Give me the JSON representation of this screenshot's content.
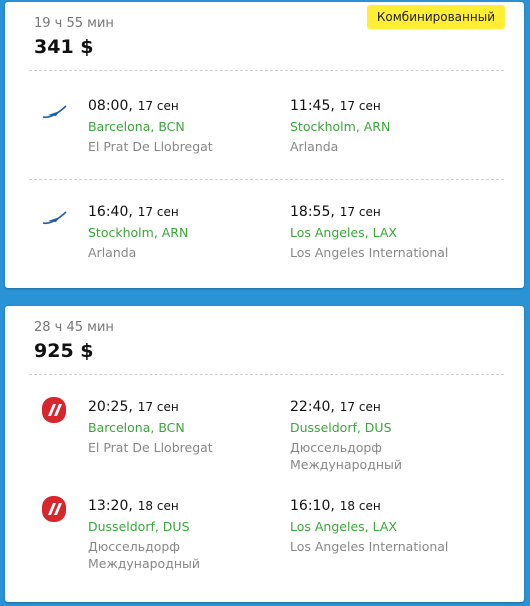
{
  "results": [
    {
      "duration": "19 ч 55 мин",
      "price": "341 $",
      "badge": "Комбинированный",
      "segments": [
        {
          "airline_icon": "blue-swoosh-airline-logo",
          "dep_time": "08:00,",
          "dep_date": "17 сен",
          "dep_city": "Barcelona, BCN",
          "dep_airport": "El Prat De Llobregat",
          "arr_time": "11:45,",
          "arr_date": "17 сен",
          "arr_city": "Stockholm, ARN",
          "arr_airport": "Arlanda"
        },
        {
          "airline_icon": "blue-swoosh-airline-logo",
          "dep_time": "16:40,",
          "dep_date": "17 сен",
          "dep_city": "Stockholm, ARN",
          "dep_airport": "Arlanda",
          "arr_time": "18:55,",
          "arr_date": "17 сен",
          "arr_city": "Los Angeles, LAX",
          "arr_airport": "Los Angeles International"
        }
      ]
    },
    {
      "duration": "28 ч 45 мин",
      "price": "925 $",
      "segments": [
        {
          "airline_icon": "red-airline-logo",
          "dep_time": "20:25,",
          "dep_date": "17 сен",
          "dep_city": "Barcelona, BCN",
          "dep_airport": "El Prat De Llobregat",
          "arr_time": "22:40,",
          "arr_date": "17 сен",
          "arr_city": "Dusseldorf, DUS",
          "arr_airport": "Дюссельдорф Международный"
        },
        {
          "airline_icon": "red-airline-logo",
          "dep_time": "13:20,",
          "dep_date": "18 сен",
          "dep_city": "Dusseldorf, DUS",
          "dep_airport": "Дюссельдорф Международный",
          "arr_time": "16:10,",
          "arr_date": "18 сен",
          "arr_city": "Los Angeles, LAX",
          "arr_airport": "Los Angeles International"
        }
      ]
    }
  ],
  "colors": {
    "background": "#2a93d5",
    "city_green": "#3aa63a",
    "badge_yellow": "#ffee33",
    "logo_red": "#d7262c",
    "logo_blue": "#1f5fa8"
  }
}
